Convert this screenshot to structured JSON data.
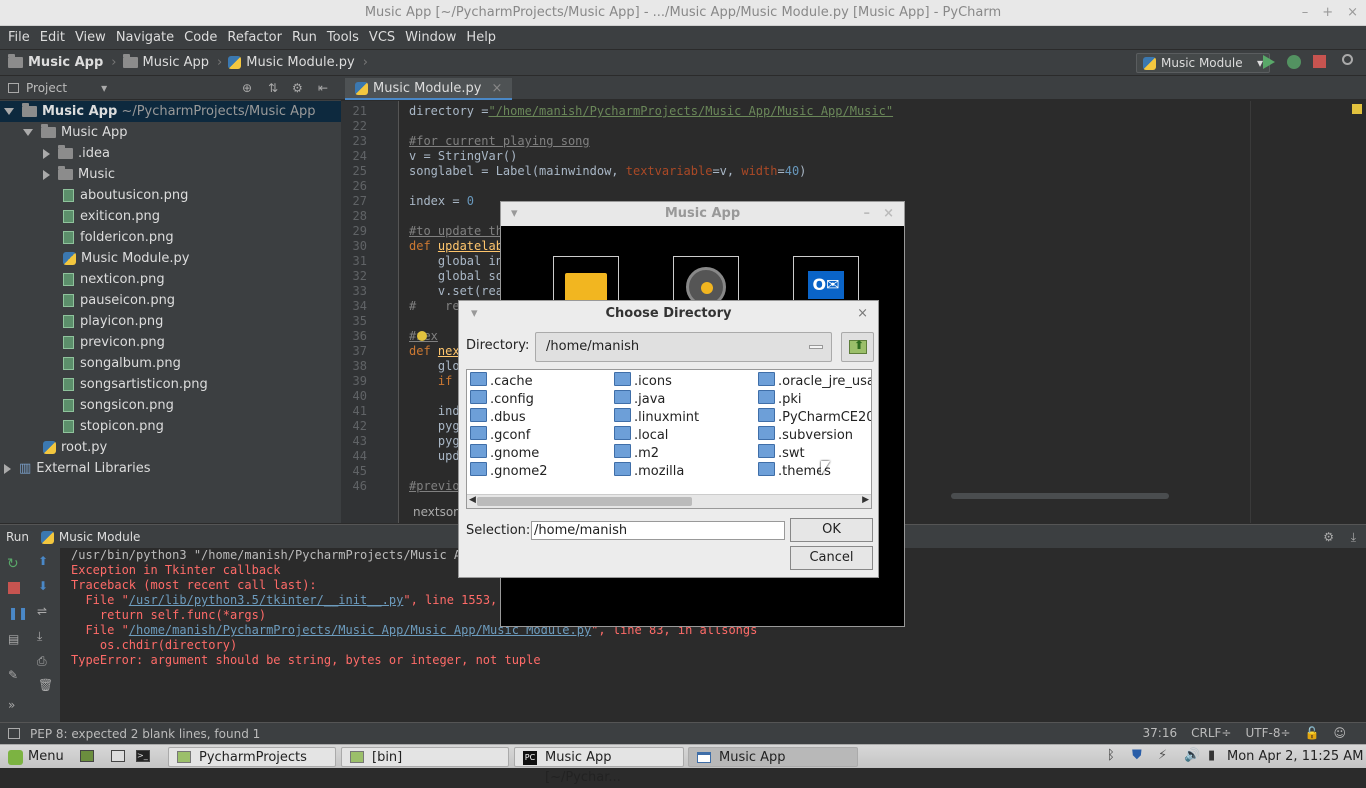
{
  "window": {
    "title": "Music App [~/PycharmProjects/Music App] - .../Music App/Music Module.py [Music App] - PyCharm",
    "controls": [
      "–",
      "+",
      "×"
    ]
  },
  "menu": [
    "File",
    "Edit",
    "View",
    "Navigate",
    "Code",
    "Refactor",
    "Run",
    "Tools",
    "VCS",
    "Window",
    "Help"
  ],
  "breadcrumb": [
    "Music App",
    "Music App",
    "Music Module.py"
  ],
  "run_config": "Music Module",
  "project_panel": {
    "title": "Project"
  },
  "tree": [
    {
      "label": "Music App",
      "suffix": "~/PycharmProjects/Music App"
    },
    {
      "label": "Music App"
    },
    {
      "label": ".idea"
    },
    {
      "label": "Music"
    },
    {
      "label": "aboutusicon.png"
    },
    {
      "label": "exiticon.png"
    },
    {
      "label": "foldericon.png"
    },
    {
      "label": "Music Module.py"
    },
    {
      "label": "nexticon.png"
    },
    {
      "label": "pauseicon.png"
    },
    {
      "label": "playicon.png"
    },
    {
      "label": "previcon.png"
    },
    {
      "label": "songalbum.png"
    },
    {
      "label": "songsartisticon.png"
    },
    {
      "label": "songsicon.png"
    },
    {
      "label": "stopicon.png"
    },
    {
      "label": "root.py"
    },
    {
      "label": "External Libraries"
    }
  ],
  "editor_tab": "Music Module.py",
  "line_numbers": [
    "21",
    "22",
    "23",
    "24",
    "25",
    "26",
    "27",
    "28",
    "29",
    "30",
    "31",
    "32",
    "33",
    "34",
    "35",
    "36",
    "37",
    "38",
    "39",
    "40",
    "41",
    "42",
    "43",
    "44",
    "45",
    "46"
  ],
  "code": {
    "l21a": "directory =",
    "l21b": "\"/home/manish/PycharmProjects/Music App/Music App/Music\"",
    "l23": "#for current playing song",
    "l24": "v = StringVar()",
    "l25a": "songlabel = Label(mainwindow, ",
    "l25b": "textvariable",
    "l25c": "=v, ",
    "l25d": "width",
    "l25e": "=",
    "l25f": "40",
    "l25g": ")",
    "l27a": "index = ",
    "l27b": "0",
    "l29": "#to update th",
    "l30a": "def ",
    "l30b": "updatelab",
    "l31": "    global in",
    "l32": "    global so",
    "l33": "    v.set(rea",
    "l34": "#    re",
    "l36": "#nex",
    "l37a": "def ",
    "l37b": "nex",
    "l38": "    glo",
    "l39a": "    ",
    "l39b": "if",
    "l41": "    ind",
    "l42": "    pyg",
    "l43": "    pyg",
    "l44": "    upd",
    "l46": "#previo",
    "hint": "nextson"
  },
  "run_panel": {
    "label": "Run",
    "config": "Music Module"
  },
  "console": {
    "c1": "/usr/bin/python3 \"/home/manish/PycharmProjects/Music App",
    "c2": "Exception in Tkinter callback",
    "c3": "Traceback (most recent call last):",
    "c4a": "  File \"",
    "c4b": "/usr/lib/python3.5/tkinter/__init__.py",
    "c4c": "\", line 1553, i",
    "c5": "    return self.func(*args)",
    "c6a": "  File \"",
    "c6b": "/home/manish/PycharmProjects/Music App/Music App/Music Module.py",
    "c6c": "\", line 83, in allsongs",
    "c7": "    os.chdir(directory)",
    "c8": "TypeError: argument should be string, bytes or integer, not tuple"
  },
  "status": {
    "message": "PEP 8: expected 2 blank lines, found 1",
    "position": "37:16",
    "line_sep": "CRLF÷",
    "encoding": "UTF-8÷"
  },
  "taskbar": {
    "menu": "Menu",
    "items": [
      "PycharmProjects",
      "[bin]",
      "Music App [~/Pychar...",
      "Music App"
    ],
    "clock": "Mon Apr 2, 11:25 AM"
  },
  "music_app": {
    "title": "Music App"
  },
  "dialog": {
    "title": "Choose Directory",
    "directory_label": "Directory:",
    "directory_value": "/home/manish",
    "folders_col1": [
      ".cache",
      ".config",
      ".dbus",
      ".gconf",
      ".gnome",
      ".gnome2"
    ],
    "folders_col2": [
      ".icons",
      ".java",
      ".linuxmint",
      ".local",
      ".m2",
      ".mozilla"
    ],
    "folders_col3": [
      ".oracle_jre_usag",
      ".pki",
      ".PyCharmCE201",
      ".subversion",
      ".swt",
      ".themes"
    ],
    "selection_label": "Selection:",
    "selection_value": "/home/manish",
    "ok": "OK",
    "cancel": "Cancel"
  },
  "colors": {
    "accent": "#4a88c7",
    "error": "#ff6b68",
    "link": "#6d9cbe",
    "keyword": "#cc7832"
  }
}
